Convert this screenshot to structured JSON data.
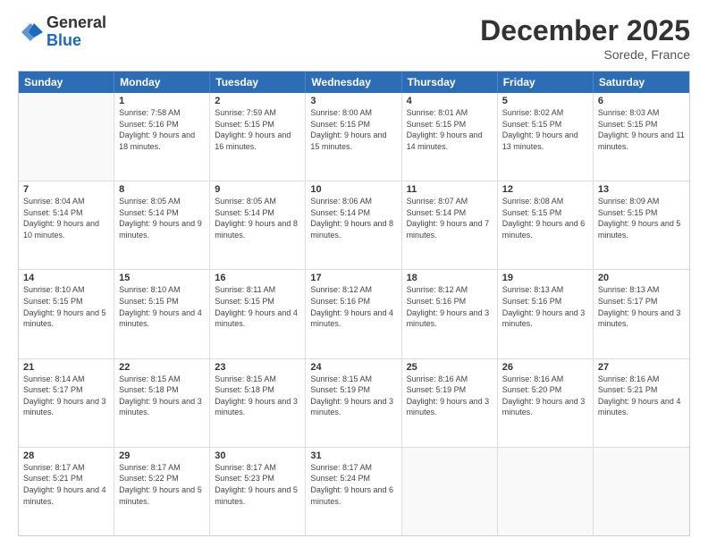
{
  "logo": {
    "general": "General",
    "blue": "Blue"
  },
  "title": "December 2025",
  "subtitle": "Sorede, France",
  "header_days": [
    "Sunday",
    "Monday",
    "Tuesday",
    "Wednesday",
    "Thursday",
    "Friday",
    "Saturday"
  ],
  "weeks": [
    [
      {
        "day": "",
        "sunrise": "",
        "sunset": "",
        "daylight": ""
      },
      {
        "day": "1",
        "sunrise": "Sunrise: 7:58 AM",
        "sunset": "Sunset: 5:16 PM",
        "daylight": "Daylight: 9 hours and 18 minutes."
      },
      {
        "day": "2",
        "sunrise": "Sunrise: 7:59 AM",
        "sunset": "Sunset: 5:15 PM",
        "daylight": "Daylight: 9 hours and 16 minutes."
      },
      {
        "day": "3",
        "sunrise": "Sunrise: 8:00 AM",
        "sunset": "Sunset: 5:15 PM",
        "daylight": "Daylight: 9 hours and 15 minutes."
      },
      {
        "day": "4",
        "sunrise": "Sunrise: 8:01 AM",
        "sunset": "Sunset: 5:15 PM",
        "daylight": "Daylight: 9 hours and 14 minutes."
      },
      {
        "day": "5",
        "sunrise": "Sunrise: 8:02 AM",
        "sunset": "Sunset: 5:15 PM",
        "daylight": "Daylight: 9 hours and 13 minutes."
      },
      {
        "day": "6",
        "sunrise": "Sunrise: 8:03 AM",
        "sunset": "Sunset: 5:15 PM",
        "daylight": "Daylight: 9 hours and 11 minutes."
      }
    ],
    [
      {
        "day": "7",
        "sunrise": "Sunrise: 8:04 AM",
        "sunset": "Sunset: 5:14 PM",
        "daylight": "Daylight: 9 hours and 10 minutes."
      },
      {
        "day": "8",
        "sunrise": "Sunrise: 8:05 AM",
        "sunset": "Sunset: 5:14 PM",
        "daylight": "Daylight: 9 hours and 9 minutes."
      },
      {
        "day": "9",
        "sunrise": "Sunrise: 8:05 AM",
        "sunset": "Sunset: 5:14 PM",
        "daylight": "Daylight: 9 hours and 8 minutes."
      },
      {
        "day": "10",
        "sunrise": "Sunrise: 8:06 AM",
        "sunset": "Sunset: 5:14 PM",
        "daylight": "Daylight: 9 hours and 8 minutes."
      },
      {
        "day": "11",
        "sunrise": "Sunrise: 8:07 AM",
        "sunset": "Sunset: 5:14 PM",
        "daylight": "Daylight: 9 hours and 7 minutes."
      },
      {
        "day": "12",
        "sunrise": "Sunrise: 8:08 AM",
        "sunset": "Sunset: 5:15 PM",
        "daylight": "Daylight: 9 hours and 6 minutes."
      },
      {
        "day": "13",
        "sunrise": "Sunrise: 8:09 AM",
        "sunset": "Sunset: 5:15 PM",
        "daylight": "Daylight: 9 hours and 5 minutes."
      }
    ],
    [
      {
        "day": "14",
        "sunrise": "Sunrise: 8:10 AM",
        "sunset": "Sunset: 5:15 PM",
        "daylight": "Daylight: 9 hours and 5 minutes."
      },
      {
        "day": "15",
        "sunrise": "Sunrise: 8:10 AM",
        "sunset": "Sunset: 5:15 PM",
        "daylight": "Daylight: 9 hours and 4 minutes."
      },
      {
        "day": "16",
        "sunrise": "Sunrise: 8:11 AM",
        "sunset": "Sunset: 5:15 PM",
        "daylight": "Daylight: 9 hours and 4 minutes."
      },
      {
        "day": "17",
        "sunrise": "Sunrise: 8:12 AM",
        "sunset": "Sunset: 5:16 PM",
        "daylight": "Daylight: 9 hours and 4 minutes."
      },
      {
        "day": "18",
        "sunrise": "Sunrise: 8:12 AM",
        "sunset": "Sunset: 5:16 PM",
        "daylight": "Daylight: 9 hours and 3 minutes."
      },
      {
        "day": "19",
        "sunrise": "Sunrise: 8:13 AM",
        "sunset": "Sunset: 5:16 PM",
        "daylight": "Daylight: 9 hours and 3 minutes."
      },
      {
        "day": "20",
        "sunrise": "Sunrise: 8:13 AM",
        "sunset": "Sunset: 5:17 PM",
        "daylight": "Daylight: 9 hours and 3 minutes."
      }
    ],
    [
      {
        "day": "21",
        "sunrise": "Sunrise: 8:14 AM",
        "sunset": "Sunset: 5:17 PM",
        "daylight": "Daylight: 9 hours and 3 minutes."
      },
      {
        "day": "22",
        "sunrise": "Sunrise: 8:15 AM",
        "sunset": "Sunset: 5:18 PM",
        "daylight": "Daylight: 9 hours and 3 minutes."
      },
      {
        "day": "23",
        "sunrise": "Sunrise: 8:15 AM",
        "sunset": "Sunset: 5:18 PM",
        "daylight": "Daylight: 9 hours and 3 minutes."
      },
      {
        "day": "24",
        "sunrise": "Sunrise: 8:15 AM",
        "sunset": "Sunset: 5:19 PM",
        "daylight": "Daylight: 9 hours and 3 minutes."
      },
      {
        "day": "25",
        "sunrise": "Sunrise: 8:16 AM",
        "sunset": "Sunset: 5:19 PM",
        "daylight": "Daylight: 9 hours and 3 minutes."
      },
      {
        "day": "26",
        "sunrise": "Sunrise: 8:16 AM",
        "sunset": "Sunset: 5:20 PM",
        "daylight": "Daylight: 9 hours and 3 minutes."
      },
      {
        "day": "27",
        "sunrise": "Sunrise: 8:16 AM",
        "sunset": "Sunset: 5:21 PM",
        "daylight": "Daylight: 9 hours and 4 minutes."
      }
    ],
    [
      {
        "day": "28",
        "sunrise": "Sunrise: 8:17 AM",
        "sunset": "Sunset: 5:21 PM",
        "daylight": "Daylight: 9 hours and 4 minutes."
      },
      {
        "day": "29",
        "sunrise": "Sunrise: 8:17 AM",
        "sunset": "Sunset: 5:22 PM",
        "daylight": "Daylight: 9 hours and 5 minutes."
      },
      {
        "day": "30",
        "sunrise": "Sunrise: 8:17 AM",
        "sunset": "Sunset: 5:23 PM",
        "daylight": "Daylight: 9 hours and 5 minutes."
      },
      {
        "day": "31",
        "sunrise": "Sunrise: 8:17 AM",
        "sunset": "Sunset: 5:24 PM",
        "daylight": "Daylight: 9 hours and 6 minutes."
      },
      {
        "day": "",
        "sunrise": "",
        "sunset": "",
        "daylight": ""
      },
      {
        "day": "",
        "sunrise": "",
        "sunset": "",
        "daylight": ""
      },
      {
        "day": "",
        "sunrise": "",
        "sunset": "",
        "daylight": ""
      }
    ]
  ]
}
